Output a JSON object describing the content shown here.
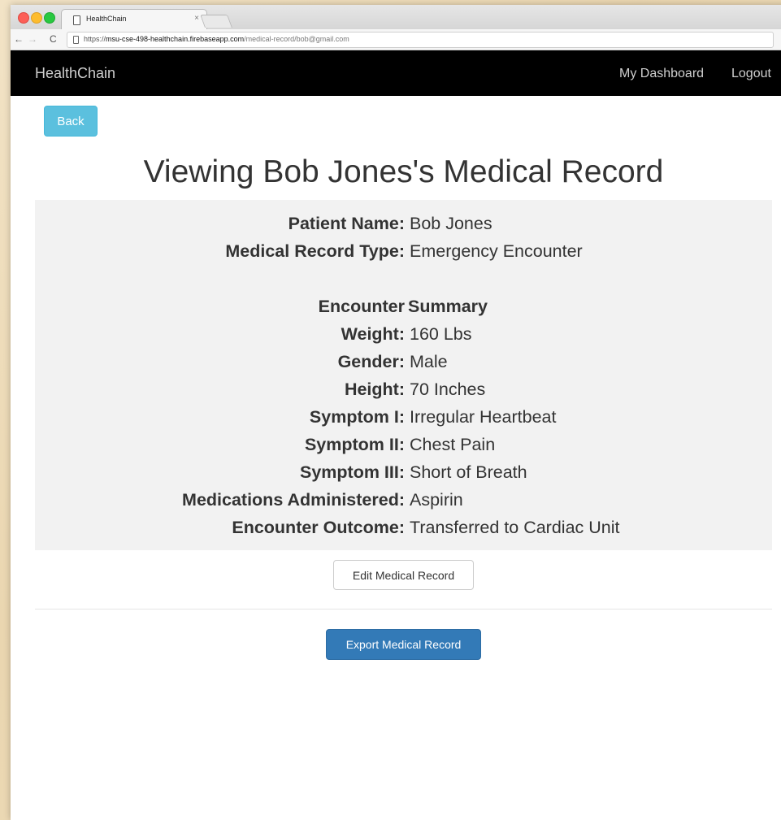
{
  "browser": {
    "tab_title": "HealthChain",
    "tab_close": "×",
    "url_scheme": "https://",
    "url_host": "msu-cse-498-healthchain.firebaseapp.com",
    "url_path": "/medical-record/bob@gmail.com",
    "back_glyph": "←",
    "forward_glyph": "→",
    "reload_glyph": "C"
  },
  "navbar": {
    "brand": "HealthChain",
    "links": [
      "My Dashboard",
      "Logout"
    ]
  },
  "page": {
    "back_label": "Back",
    "title": "Viewing Bob Jones's Medical Record",
    "edit_label": "Edit Medical Record",
    "export_label": "Export Medical Record"
  },
  "record": {
    "header_fields": [
      {
        "label": "Patient Name:",
        "value": "Bob Jones"
      },
      {
        "label": "Medical Record Type:",
        "value": "Emergency Encounter"
      }
    ],
    "section_label": "Encounter",
    "section_value": "Summary",
    "fields": [
      {
        "label": "Weight:",
        "value": "160 Lbs"
      },
      {
        "label": "Gender:",
        "value": "Male"
      },
      {
        "label": "Height:",
        "value": "70 Inches"
      },
      {
        "label": "Symptom I:",
        "value": "Irregular Heartbeat"
      },
      {
        "label": "Symptom II:",
        "value": "Chest Pain"
      },
      {
        "label": "Symptom III:",
        "value": "Short of Breath"
      },
      {
        "label": "Medications Administered:",
        "value": "Aspirin"
      },
      {
        "label": "Encounter Outcome:",
        "value": "Transferred to Cardiac Unit"
      }
    ]
  },
  "colors": {
    "navbar_bg": "#000000",
    "back_button": "#5bc0de",
    "export_button": "#337ab7",
    "record_bg": "#f2f2f2"
  }
}
